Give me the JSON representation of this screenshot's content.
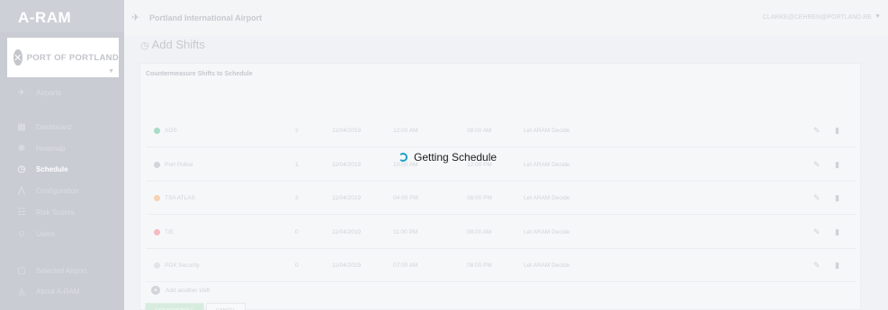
{
  "app": {
    "logo": "A-RAM"
  },
  "org": {
    "name": "PORT OF PORTLAND"
  },
  "sidebar": {
    "items": [
      {
        "label": "Airports",
        "icon": "plane-icon"
      },
      {
        "label": "Dashboard",
        "icon": "dashboard-icon"
      },
      {
        "label": "Heatmap",
        "icon": "heatmap-icon"
      },
      {
        "label": "Schedule",
        "icon": "clock-icon",
        "active": true
      },
      {
        "label": "Configuration",
        "icon": "configuration-icon"
      },
      {
        "label": "Risk Scores",
        "icon": "list-icon"
      },
      {
        "label": "Users",
        "icon": "users-icon"
      },
      {
        "label": "Selected Airport",
        "icon": "airport-icon"
      },
      {
        "label": "About A-RAM",
        "icon": "info-icon"
      }
    ]
  },
  "header": {
    "title": "Portland International Airport",
    "user": "CLARKE@CEHREN@PORTLAND.RE"
  },
  "page": {
    "title": "Add Shifts"
  },
  "card": {
    "title": "Countermeasure Shifts to Schedule"
  },
  "rows": [
    {
      "name": "AOS",
      "count": "2",
      "date": "11/04/2019",
      "start": "12:00 AM",
      "end": "08:00 AM",
      "assign": "Let ARAM Decide",
      "color": "#a9dcc6"
    },
    {
      "name": "Port Police",
      "count": "1",
      "date": "11/04/2019",
      "start": "10:00 AM",
      "end": "12:00 PM",
      "assign": "Let ARAM Decide",
      "color": "#d2d4d9"
    },
    {
      "name": "TSA ATLAS",
      "count": "3",
      "date": "11/04/2019",
      "start": "04:00 PM",
      "end": "08:00 PM",
      "assign": "Let ARAM Decide",
      "color": "#f5d3b3"
    },
    {
      "name": "TIE",
      "count": "0",
      "date": "11/04/2019",
      "start": "11:00 PM",
      "end": "08:00 AM",
      "assign": "Let ARAM Decide",
      "color": "#f3bcc0"
    },
    {
      "name": "PDX Security",
      "count": "0",
      "date": "11/04/2019",
      "start": "07:00 AM",
      "end": "08:00 PM",
      "assign": "Let ARAM Decide",
      "color": "#e3e4e8"
    }
  ],
  "actions": {
    "add_shift": "Add another shift",
    "get_schedule": "GET SCHEDULE",
    "cancel": "CANCEL"
  },
  "loading": {
    "text": "Getting Schedule"
  },
  "colors": {
    "accent": "#19a0c7",
    "sidebar": "#c9ccd3",
    "primary_button": "#d7ecdf"
  }
}
